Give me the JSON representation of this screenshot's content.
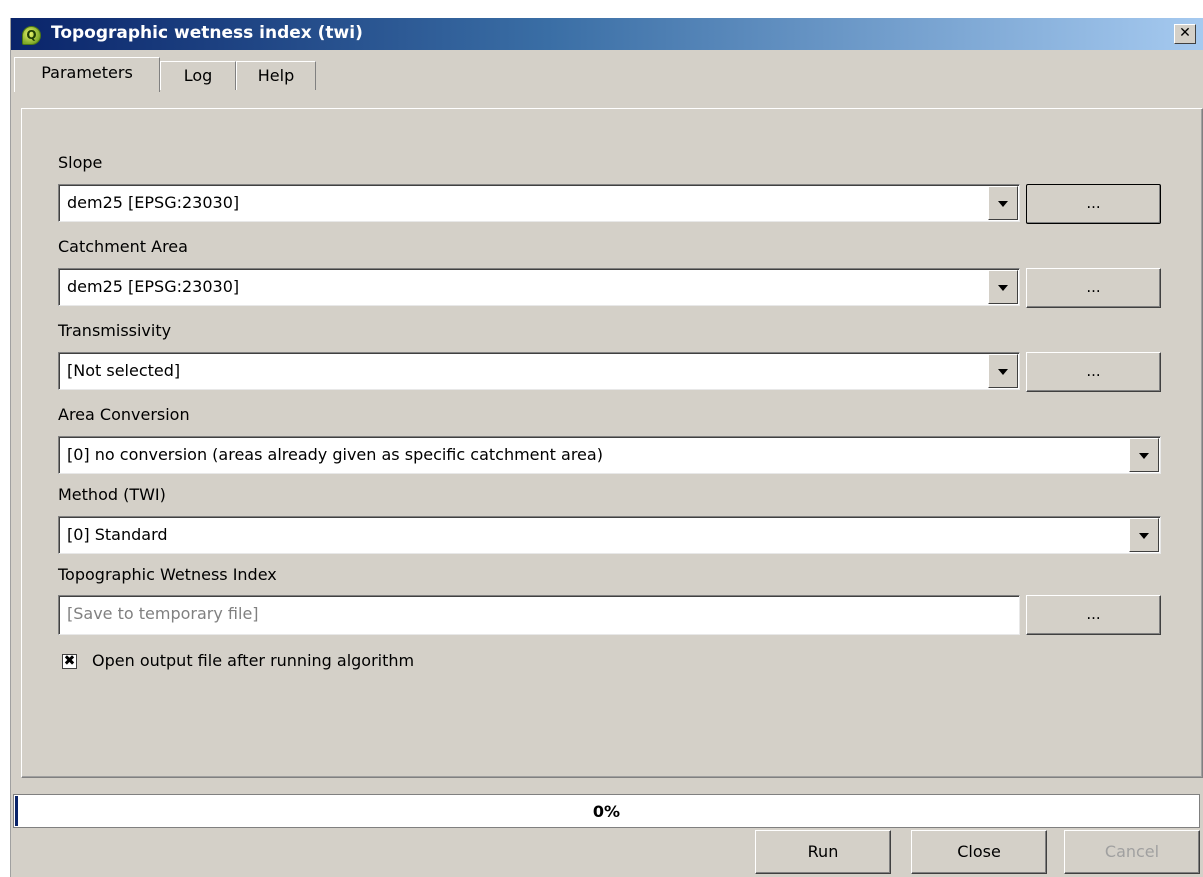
{
  "window": {
    "title": "Topographic wetness index (twi)",
    "close_glyph": "✕"
  },
  "tabs": [
    {
      "label": "Parameters",
      "active": true
    },
    {
      "label": "Log",
      "active": false
    },
    {
      "label": "Help",
      "active": false
    }
  ],
  "fields": {
    "slope": {
      "label": "Slope",
      "value": "dem25 [EPSG:23030]",
      "browse": "..."
    },
    "catchment": {
      "label": "Catchment Area",
      "value": "dem25 [EPSG:23030]",
      "browse": "..."
    },
    "transmissivity": {
      "label": "Transmissivity",
      "value": "[Not selected]",
      "browse": "..."
    },
    "area_conversion": {
      "label": "Area Conversion",
      "value": "[0] no conversion (areas already given as specific catchment area)"
    },
    "method": {
      "label": "Method (TWI)",
      "value": "[0] Standard"
    },
    "output": {
      "label": "Topographic Wetness Index",
      "placeholder": "[Save to temporary file]",
      "value": "",
      "browse": "..."
    }
  },
  "open_output": {
    "label": "Open output file after running algorithm",
    "checked": true
  },
  "progress": {
    "value": 0,
    "text": "0%"
  },
  "buttons": {
    "run": "Run",
    "close": "Close",
    "cancel": "Cancel"
  },
  "colors": {
    "titlebar_start": "#0a246a",
    "titlebar_end": "#a6caf0",
    "face": "#d4d0c8"
  },
  "icons": {
    "app": "qgis-logo-icon",
    "dropdown": "chevron-down-icon",
    "checkbox": "check-x-icon"
  }
}
